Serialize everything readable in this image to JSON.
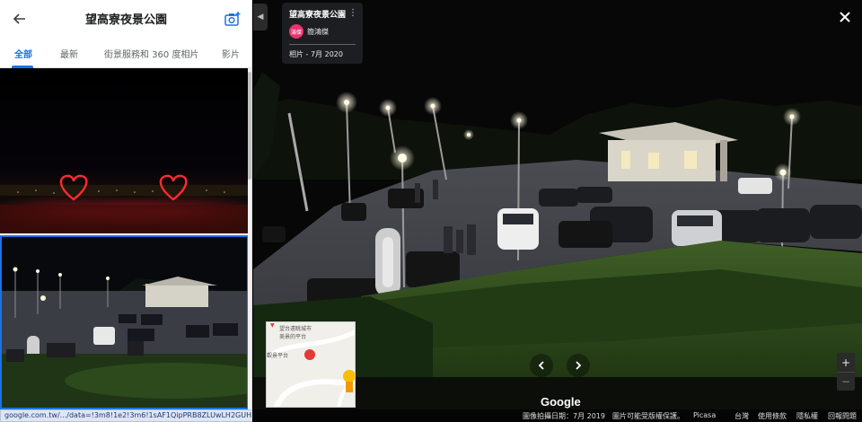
{
  "header": {
    "title": "望高寮夜景公園"
  },
  "tabs": [
    {
      "label": "全部",
      "active": true
    },
    {
      "label": "最新",
      "active": false
    },
    {
      "label": "街景服務和 360 度相片",
      "active": false
    },
    {
      "label": "影片",
      "active": false
    }
  ],
  "status_url": "google.com.tw/.../data=!3m8!1e2!3m6!1sAF1QipPRB8ZLUwLH2GUHHtvkgEk0ncJBxHb...",
  "photo_info": {
    "title": "望高寮夜景公園",
    "avatar_text": "滿傑",
    "user": "簡鴻傑",
    "date": "相片 - 7月 2020"
  },
  "minimap": {
    "label1": "望台遠眺城市",
    "label2": "美景的平台",
    "label3": "寮觀景平台"
  },
  "google_logo": "Google",
  "footer": {
    "capture_date": "圖像拍攝日期：7月 2019",
    "copyright": "圖片可能受版權保護。",
    "picasa": "Picasa",
    "taiwan": "台灣",
    "terms": "使用條款",
    "privacy": "隱私權",
    "report": "回報問題"
  },
  "colors": {
    "accent": "#1a73e8",
    "avatar": "#e8336d",
    "heart": "#ff2030"
  },
  "icons": {
    "back": "arrow-left-icon",
    "camera": "add-photo-icon",
    "close": "close-icon",
    "more": "more-vert-icon",
    "prev": "chevron-left-icon",
    "next": "chevron-right-icon",
    "pin": "map-pin-icon"
  }
}
